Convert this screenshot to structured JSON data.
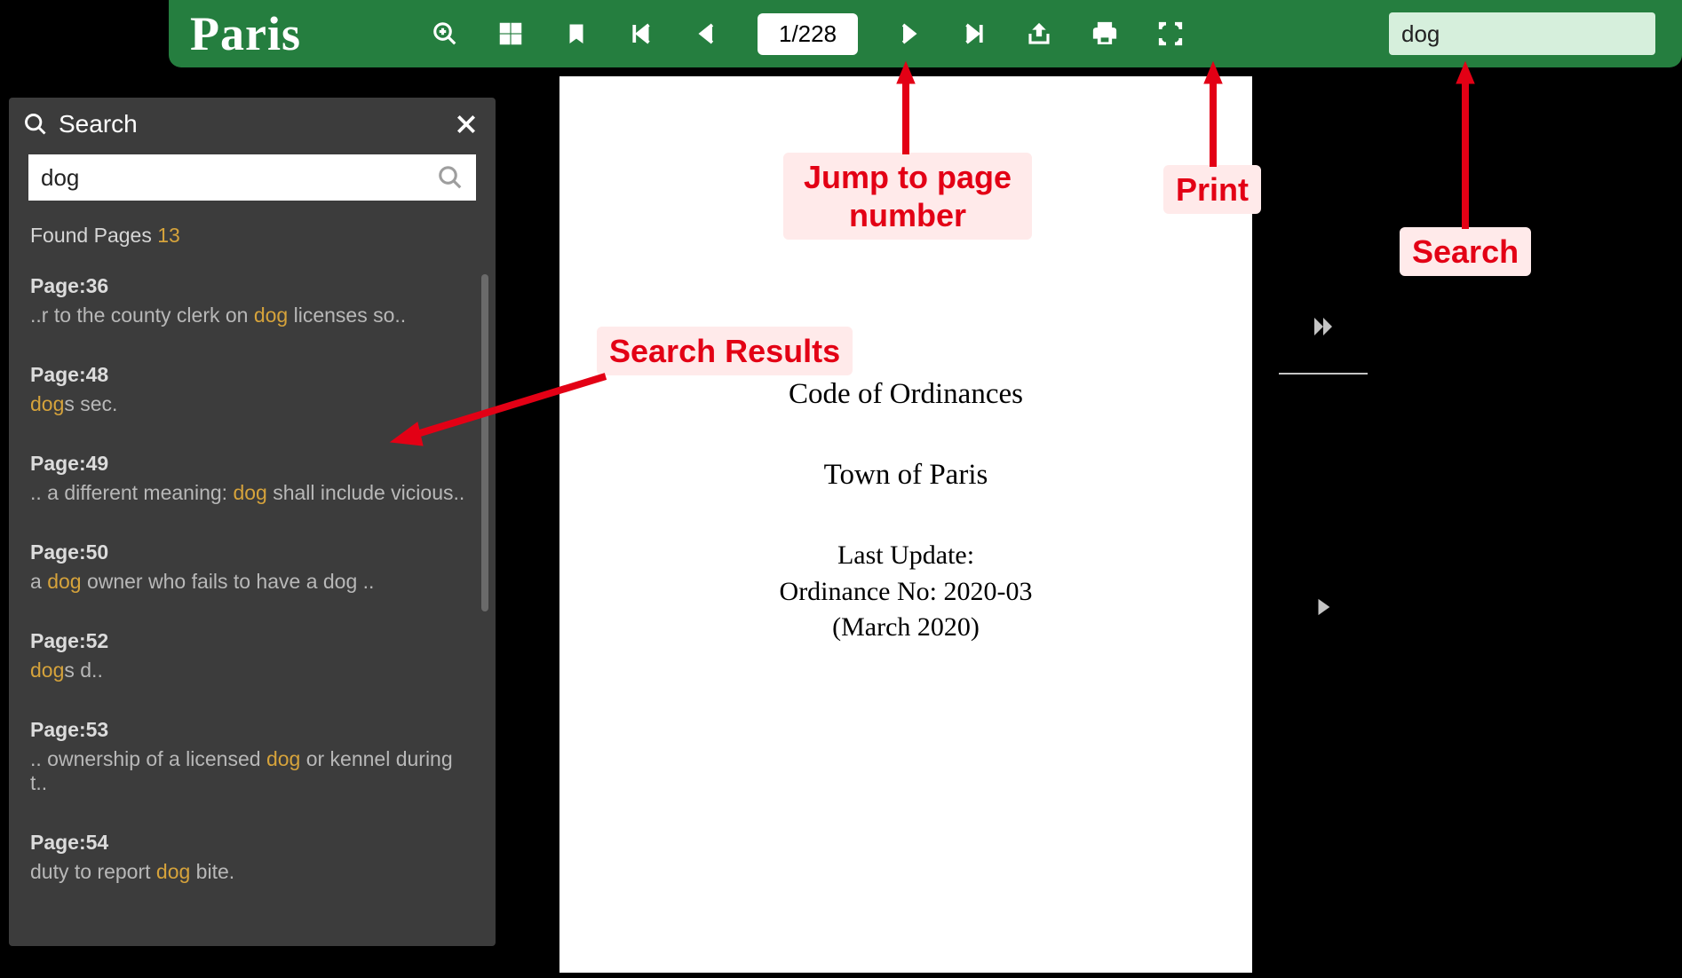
{
  "brand": "Paris",
  "toolbar": {
    "page_display": "1/228",
    "search_value": "dog"
  },
  "search_panel": {
    "title": "Search",
    "input_value": "dog",
    "found_label": "Found Pages ",
    "found_count": "13",
    "results": [
      {
        "page": "Page:36",
        "pre": "..r to the county clerk on ",
        "hl": "dog",
        "post": " licenses so.."
      },
      {
        "page": "Page:48",
        "pre": "",
        "hl": "dog",
        "post": "s sec."
      },
      {
        "page": "Page:49",
        "pre": ".. a different meaning: ",
        "hl": "dog",
        "post": " shall include vicious.."
      },
      {
        "page": "Page:50",
        "pre": "a ",
        "hl": "dog",
        "post": " owner who fails to have a dog .."
      },
      {
        "page": "Page:52",
        "pre": "",
        "hl": "dog",
        "post": "s d.."
      },
      {
        "page": "Page:53",
        "pre": ".. ownership of a licensed ",
        "hl": "dog",
        "post": " or kennel during t.."
      },
      {
        "page": "Page:54",
        "pre": "duty to report ",
        "hl": "dog",
        "post": " bite."
      }
    ]
  },
  "document": {
    "title": "Code of Ordinances",
    "subtitle": "Town of Paris",
    "last_update": "Last Update:",
    "ord_no": "Ordinance No:  2020-03",
    "date": "(March 2020)"
  },
  "annotations": {
    "jump": "Jump to page number",
    "print": "Print",
    "search": "Search",
    "results": "Search Results"
  }
}
